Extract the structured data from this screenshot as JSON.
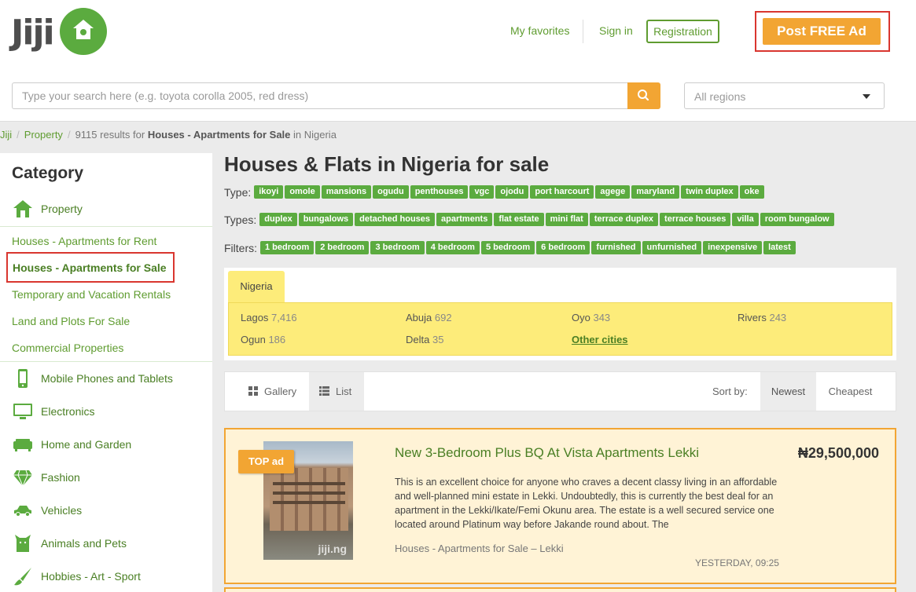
{
  "brand": {
    "logo_text": "Jiji"
  },
  "header": {
    "my_favorites": "My favorites",
    "sign_in": "Sign in",
    "registration": "Registration",
    "post_ad": "Post FREE Ad",
    "search_placeholder": "Type your search here (e.g. toyota corolla 2005, red dress)",
    "region_selected": "All regions"
  },
  "breadcrumb": {
    "home": "Jiji",
    "property": "Property",
    "results_prefix": "9115 results for",
    "results_category": "Houses - Apartments for Sale",
    "results_suffix": "in Nigeria"
  },
  "sidebar": {
    "title": "Category",
    "parent": "Property",
    "subcategories": [
      "Houses - Apartments for Rent",
      "Houses - Apartments for Sale",
      "Temporary and Vacation Rentals",
      "Land and Plots For Sale",
      "Commercial Properties"
    ],
    "categories": [
      "Mobile Phones and Tablets",
      "Electronics",
      "Home and Garden",
      "Fashion",
      "Vehicles",
      "Animals and Pets",
      "Hobbies - Art - Sport"
    ]
  },
  "main": {
    "title": "Houses & Flats in Nigeria for sale",
    "type_label": "Type:",
    "type_tags": [
      "ikoyi",
      "omole",
      "mansions",
      "ogudu",
      "penthouses",
      "vgc",
      "ojodu",
      "port harcourt",
      "agege",
      "maryland",
      "twin duplex",
      "oke"
    ],
    "types_label": "Types:",
    "types_tags": [
      "duplex",
      "bungalows",
      "detached houses",
      "apartments",
      "flat estate",
      "mini flat",
      "terrace duplex",
      "terrace houses",
      "villa",
      "room bungalow"
    ],
    "filters_label": "Filters:",
    "filter_tags": [
      "1 bedroom",
      "2 bedroom",
      "3 bedroom",
      "4 bedroom",
      "5 bedroom",
      "6 bedroom",
      "furnished",
      "unfurnished",
      "inexpensive",
      "latest"
    ]
  },
  "regions": {
    "tab": "Nigeria",
    "cities": [
      {
        "name": "Lagos",
        "count": "7,416"
      },
      {
        "name": "Abuja",
        "count": "692"
      },
      {
        "name": "Oyo",
        "count": "343"
      },
      {
        "name": "Rivers",
        "count": "243"
      },
      {
        "name": "Ogun",
        "count": "186"
      },
      {
        "name": "Delta",
        "count": "35"
      }
    ],
    "other": "Other cities"
  },
  "view": {
    "gallery": "Gallery",
    "list": "List",
    "sort_by": "Sort by:",
    "newest": "Newest",
    "cheapest": "Cheapest"
  },
  "listing": {
    "badge": "TOP ad",
    "title": "New 3-Bedroom Plus BQ At Vista Apartments Lekki",
    "price": "₦29,500,000",
    "description": "This is an excellent choice for anyone who craves a decent classy living in an affordable and well-planned mini estate in Lekki. Undoubtedly, this is currently the best deal for an apartment in the Lekki/Ikate/Femi Okunu area. The estate is a well secured service one located around Platinum way before Jakande round about. The",
    "category": "Houses - Apartments for Sale – Lekki",
    "time": "YESTERDAY, 09:25",
    "image_watermark": "jiji.ng"
  },
  "colors": {
    "green": "#5bab3f",
    "orange": "#f2a533",
    "yellow": "#fdec7a",
    "highlight": "#d9362f"
  }
}
